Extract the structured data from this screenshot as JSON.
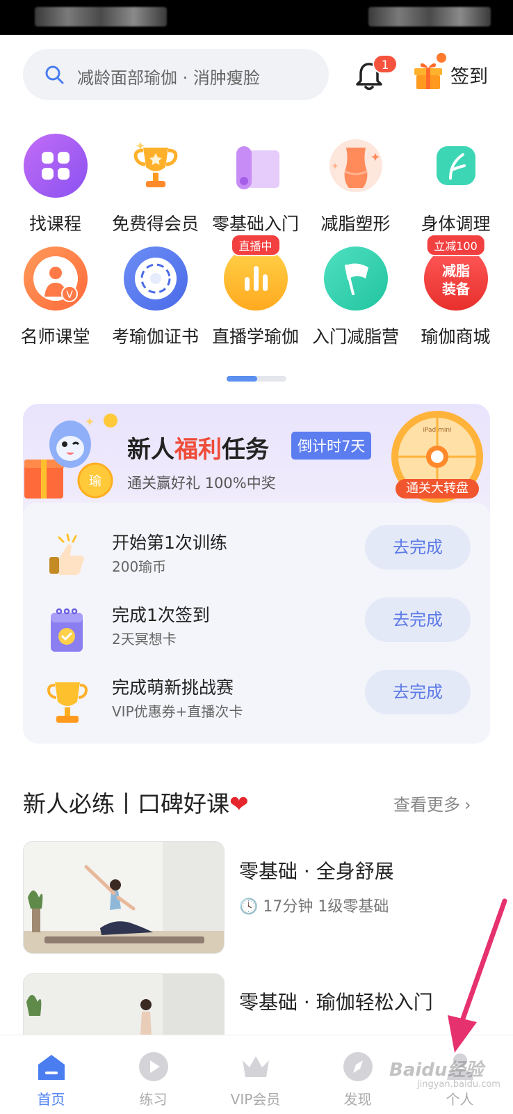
{
  "search": {
    "placeholder": "减龄面部瑜伽 · 消肿瘦脸"
  },
  "header": {
    "notification_count": "1",
    "signin_label": "签到"
  },
  "quick_entries": [
    {
      "label": "找课程",
      "icon": "grid-apps-icon"
    },
    {
      "label": "免费得会员",
      "icon": "trophy-icon"
    },
    {
      "label": "零基础入门",
      "icon": "yoga-mat-icon"
    },
    {
      "label": "减脂塑形",
      "icon": "body-shape-icon"
    },
    {
      "label": "身体调理",
      "icon": "leaf-icon"
    },
    {
      "label": "名师课堂",
      "icon": "teacher-avatar-icon"
    },
    {
      "label": "考瑜伽证书",
      "icon": "certificate-icon"
    },
    {
      "label": "直播学瑜伽",
      "icon": "live-chart-icon",
      "tag": "直播中"
    },
    {
      "label": "入门减脂营",
      "icon": "flag-icon"
    },
    {
      "label": "瑜伽商城",
      "icon": "mall-icon",
      "tag": "立减100",
      "icon_text": "减脂\n装备"
    }
  ],
  "newbie_task": {
    "title_pre": "新人",
    "title_hl": "福利",
    "title_post": "任务",
    "countdown": "倒计时7天",
    "subtitle": "通关赢好礼 100%中奖",
    "wheel_label": "通关大转盘",
    "wheel_text": "iPad mini",
    "tasks": [
      {
        "name": "开始第1次训练",
        "reward": "200瑜币",
        "button": "去完成",
        "icon": "thumbs-up-icon"
      },
      {
        "name": "完成1次签到",
        "reward": "2天冥想卡",
        "button": "去完成",
        "icon": "calendar-check-icon"
      },
      {
        "name": "完成萌新挑战赛",
        "reward": "VIP优惠券+直播次卡",
        "button": "去完成",
        "icon": "trophy-icon"
      }
    ]
  },
  "section": {
    "title": "新人必练丨口碑好课",
    "more": "查看更多"
  },
  "courses": [
    {
      "title": "零基础 · 全身舒展",
      "meta": "17分钟   1级零基础"
    },
    {
      "title": "零基础 · 瑜伽轻松入门",
      "meta": ""
    }
  ],
  "tabs": [
    {
      "label": "首页",
      "active": true
    },
    {
      "label": "练习",
      "active": false
    },
    {
      "label": "VIP会员",
      "active": false
    },
    {
      "label": "发现",
      "active": false
    },
    {
      "label": "个人",
      "active": false
    }
  ],
  "watermark": {
    "text": "Baidu经验",
    "sub": "jingyan.baidu.com"
  },
  "colors": {
    "accent": "#4a7ef0",
    "badge": "#f5533d",
    "highlight": "#ee4b38"
  }
}
